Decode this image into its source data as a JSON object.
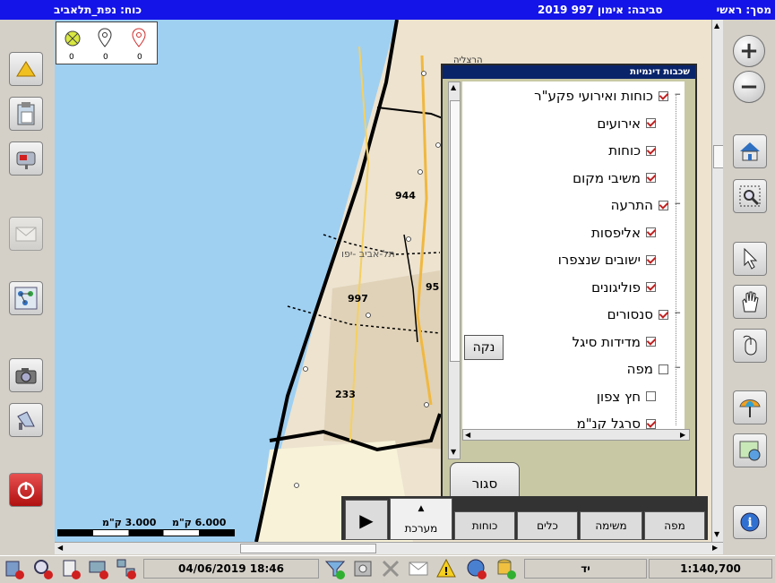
{
  "titlebar": {
    "screen": "מסך: ראשי",
    "environment": "סביבה: אימון 997 2019",
    "force": "כוח: נפת_תלאביב"
  },
  "legend": {
    "counts": [
      "0",
      "0",
      "0"
    ]
  },
  "map": {
    "labels": {
      "city": "תל-אביב -יפו",
      "herzliya": "הרצליה",
      "area_944": "944",
      "area_997": "997",
      "area_233": "233",
      "area_95": "95"
    },
    "scale": {
      "label1": "3.000 ק\"מ",
      "label2": "6.000 ק\"מ"
    }
  },
  "dialog": {
    "title": "שכבות דינמיות",
    "items": [
      {
        "label": "כוחות ואירועי פקע\"ר",
        "checked": true,
        "level": 0
      },
      {
        "label": "אירועים",
        "checked": true,
        "level": 1
      },
      {
        "label": "כוחות",
        "checked": true,
        "level": 1
      },
      {
        "label": "משיבי מקום",
        "checked": true,
        "level": 1
      },
      {
        "label": "התרעה",
        "checked": true,
        "level": 0
      },
      {
        "label": "אליפסות",
        "checked": true,
        "level": 1
      },
      {
        "label": "ישובים שנצפרו",
        "checked": true,
        "level": 1
      },
      {
        "label": "פוליגונים",
        "checked": true,
        "level": 1
      },
      {
        "label": "סנסורים",
        "checked": true,
        "level": 0
      },
      {
        "label": "מדידות סיגל",
        "checked": true,
        "level": 1
      },
      {
        "label": "מפה",
        "checked": false,
        "level": 0
      },
      {
        "label": "חץ צפון",
        "checked": false,
        "level": 1
      },
      {
        "label": "סרגל קנ\"מ",
        "checked": true,
        "level": 1
      }
    ],
    "clear_label": "נקה",
    "close_label": "סגור"
  },
  "tabs": [
    "מפה",
    "משימה",
    "כלים",
    "כוחות",
    "מערכת"
  ],
  "statusbar": {
    "datetime": "04/06/2019 18:46",
    "hand": "יד",
    "scale": "1:140,700"
  },
  "colors": {
    "titlebar": "#1414e8",
    "sea": "#9fd0f2",
    "land": "#ede3cf"
  }
}
